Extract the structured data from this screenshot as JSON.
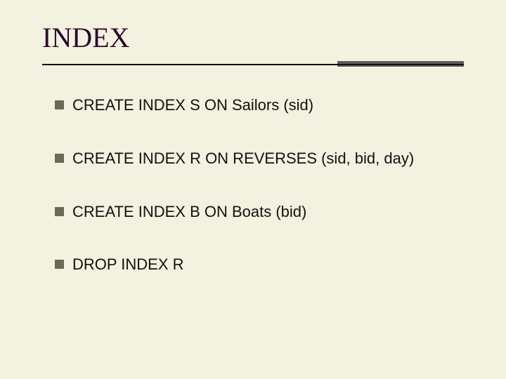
{
  "slide": {
    "title": "INDEX",
    "bullets": [
      "CREATE INDEX S ON Sailors (sid)",
      "CREATE INDEX R ON REVERSES (sid, bid, day)",
      "CREATE INDEX B ON Boats (bid)",
      "DROP INDEX R"
    ]
  }
}
